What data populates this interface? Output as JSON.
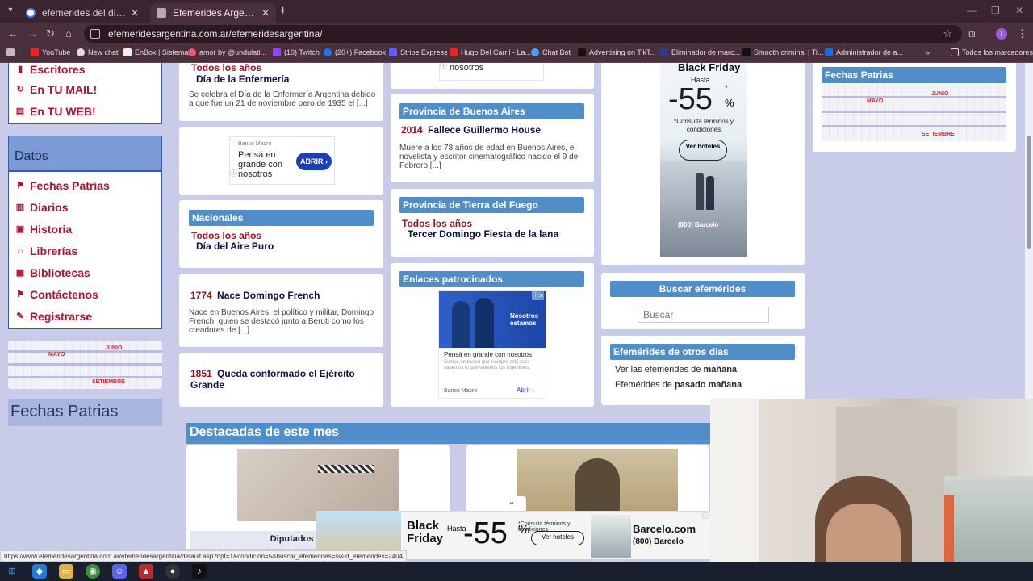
{
  "browser": {
    "tabs": [
      {
        "title": "efemerides del dia de hoy - Bu",
        "active": false
      },
      {
        "title": "Efemerides Argentina",
        "active": true
      }
    ],
    "url": "efemeridesargentina.com.ar/efemeridesargentina/",
    "bookmarks": [
      "YouTube",
      "New chat",
      "EnBox | Sistema",
      "amor by @undulati...",
      "(10) Twitch",
      "(20+) Facebook",
      "Stripe Express",
      "Hugo Del Carril - La...",
      "Chat Bot",
      "Advertising on TikT...",
      "Eliminador de marc...",
      "Smooth criminal | Ti...",
      "Administrador de a..."
    ],
    "all_bookmarks": "Todos los marcadores",
    "status_url": "https://www.efemeridesargentina.com.ar/efemeridesargentina/default.asp?opt=1&condicion=5&buscar_efemerides=si&id_efemerides=2404",
    "profile_initial": "I"
  },
  "sidebar": {
    "top_items": [
      "Escritores",
      "En TU MAIL!",
      "En TU WEB!"
    ],
    "datos_title": "Datos",
    "datos_items": [
      "Fechas Patrias",
      "Diarios",
      "Historia",
      "Librerías",
      "Bibliotecas",
      "Contáctenos",
      "Registrarse"
    ],
    "calendar_tags": [
      "MAYO",
      "JUNIO",
      "SETIEMBRE"
    ],
    "fechas_patrias_title": "Fechas Patrias"
  },
  "col1": {
    "enfermeria": {
      "year": "Todos los años",
      "title": "Día de la Enfermería",
      "text": "Se celebra el Día de la Enfermería Argentina debido a que fue un 21 de noviembre pero de 1935 el [...]"
    },
    "ad": {
      "brand": "Banco Macro",
      "text": "Pensá en grande con nosotros",
      "cta": "ABRIR"
    },
    "nacionales": {
      "head": "Nacionales",
      "year": "Todos los años",
      "title": "Día del Aire Puro"
    },
    "french": {
      "year": "1774",
      "title": "Nace Domingo French",
      "text": "Nace en Buenos Aires, el político y militar, Domingo French, quien se destacó junto a Beruti como los creadores de [...]"
    },
    "ejercito": {
      "year": "1851",
      "title": "Queda conformado el Ejército Grande"
    }
  },
  "col2": {
    "top_snippet": "nosotros",
    "bsas": {
      "head": "Provincia de Buenos Aires",
      "year": "2014",
      "title": "Fallece Guillermo House",
      "text": "Muere a los 78 años de edad en Buenos Aires, el novelista y escritor cinematográfico nacido el 9 de Febrero [...]"
    },
    "tdf": {
      "head": "Provincia de Tierra del Fuego",
      "year": "Todos los años",
      "title": "Tercer Domingo Fiesta de la lana"
    },
    "enlaces": {
      "head": "Enlaces patrocinados",
      "ad_badge": "Nosotros estamos",
      "ad_title": "Pensá en grande con nosotros",
      "ad_text": "Somos un banco que siempre está para sabemos lo que valemos los argentinos.",
      "ad_brand": "Banco Macro",
      "ad_cta": "Abrir"
    }
  },
  "col3": {
    "ad": {
      "title": "Black Friday",
      "hasta": "Hasta",
      "pct": "-55",
      "pct_sym": "%",
      "asterisk": "*",
      "terms": "*Consulta términos y condiciones",
      "cta": "Ver hoteles",
      "brand": "(800) Barcelo"
    },
    "buscar": {
      "head": "Buscar efemérides",
      "placeholder": "Buscar"
    },
    "otros": {
      "head": "Efemérides de otros dias",
      "line1_prefix": "Ver las efemérides de",
      "line1_bold": "mañana",
      "line2_prefix": "Efemérides de",
      "line2_bold": "pasado mañana"
    }
  },
  "col4": {
    "head": "Fechas Patrias"
  },
  "destacadas": {
    "title": "Destacadas de este mes",
    "caption1": "Diputados aprueban la"
  },
  "sticky_ad": {
    "title": "Black Friday",
    "hasta": "Hasta",
    "pct": "-55",
    "pct_sym": "%",
    "terms": "*Consulta términos y condiciones",
    "cta": "Ver hoteles",
    "domain": "Barcelo.com",
    "phone": "(800) Barcelo"
  },
  "colors": {
    "accent_blue": "#4f8ec9",
    "red": "#9b1020",
    "page_bg": "#c9cce8"
  }
}
